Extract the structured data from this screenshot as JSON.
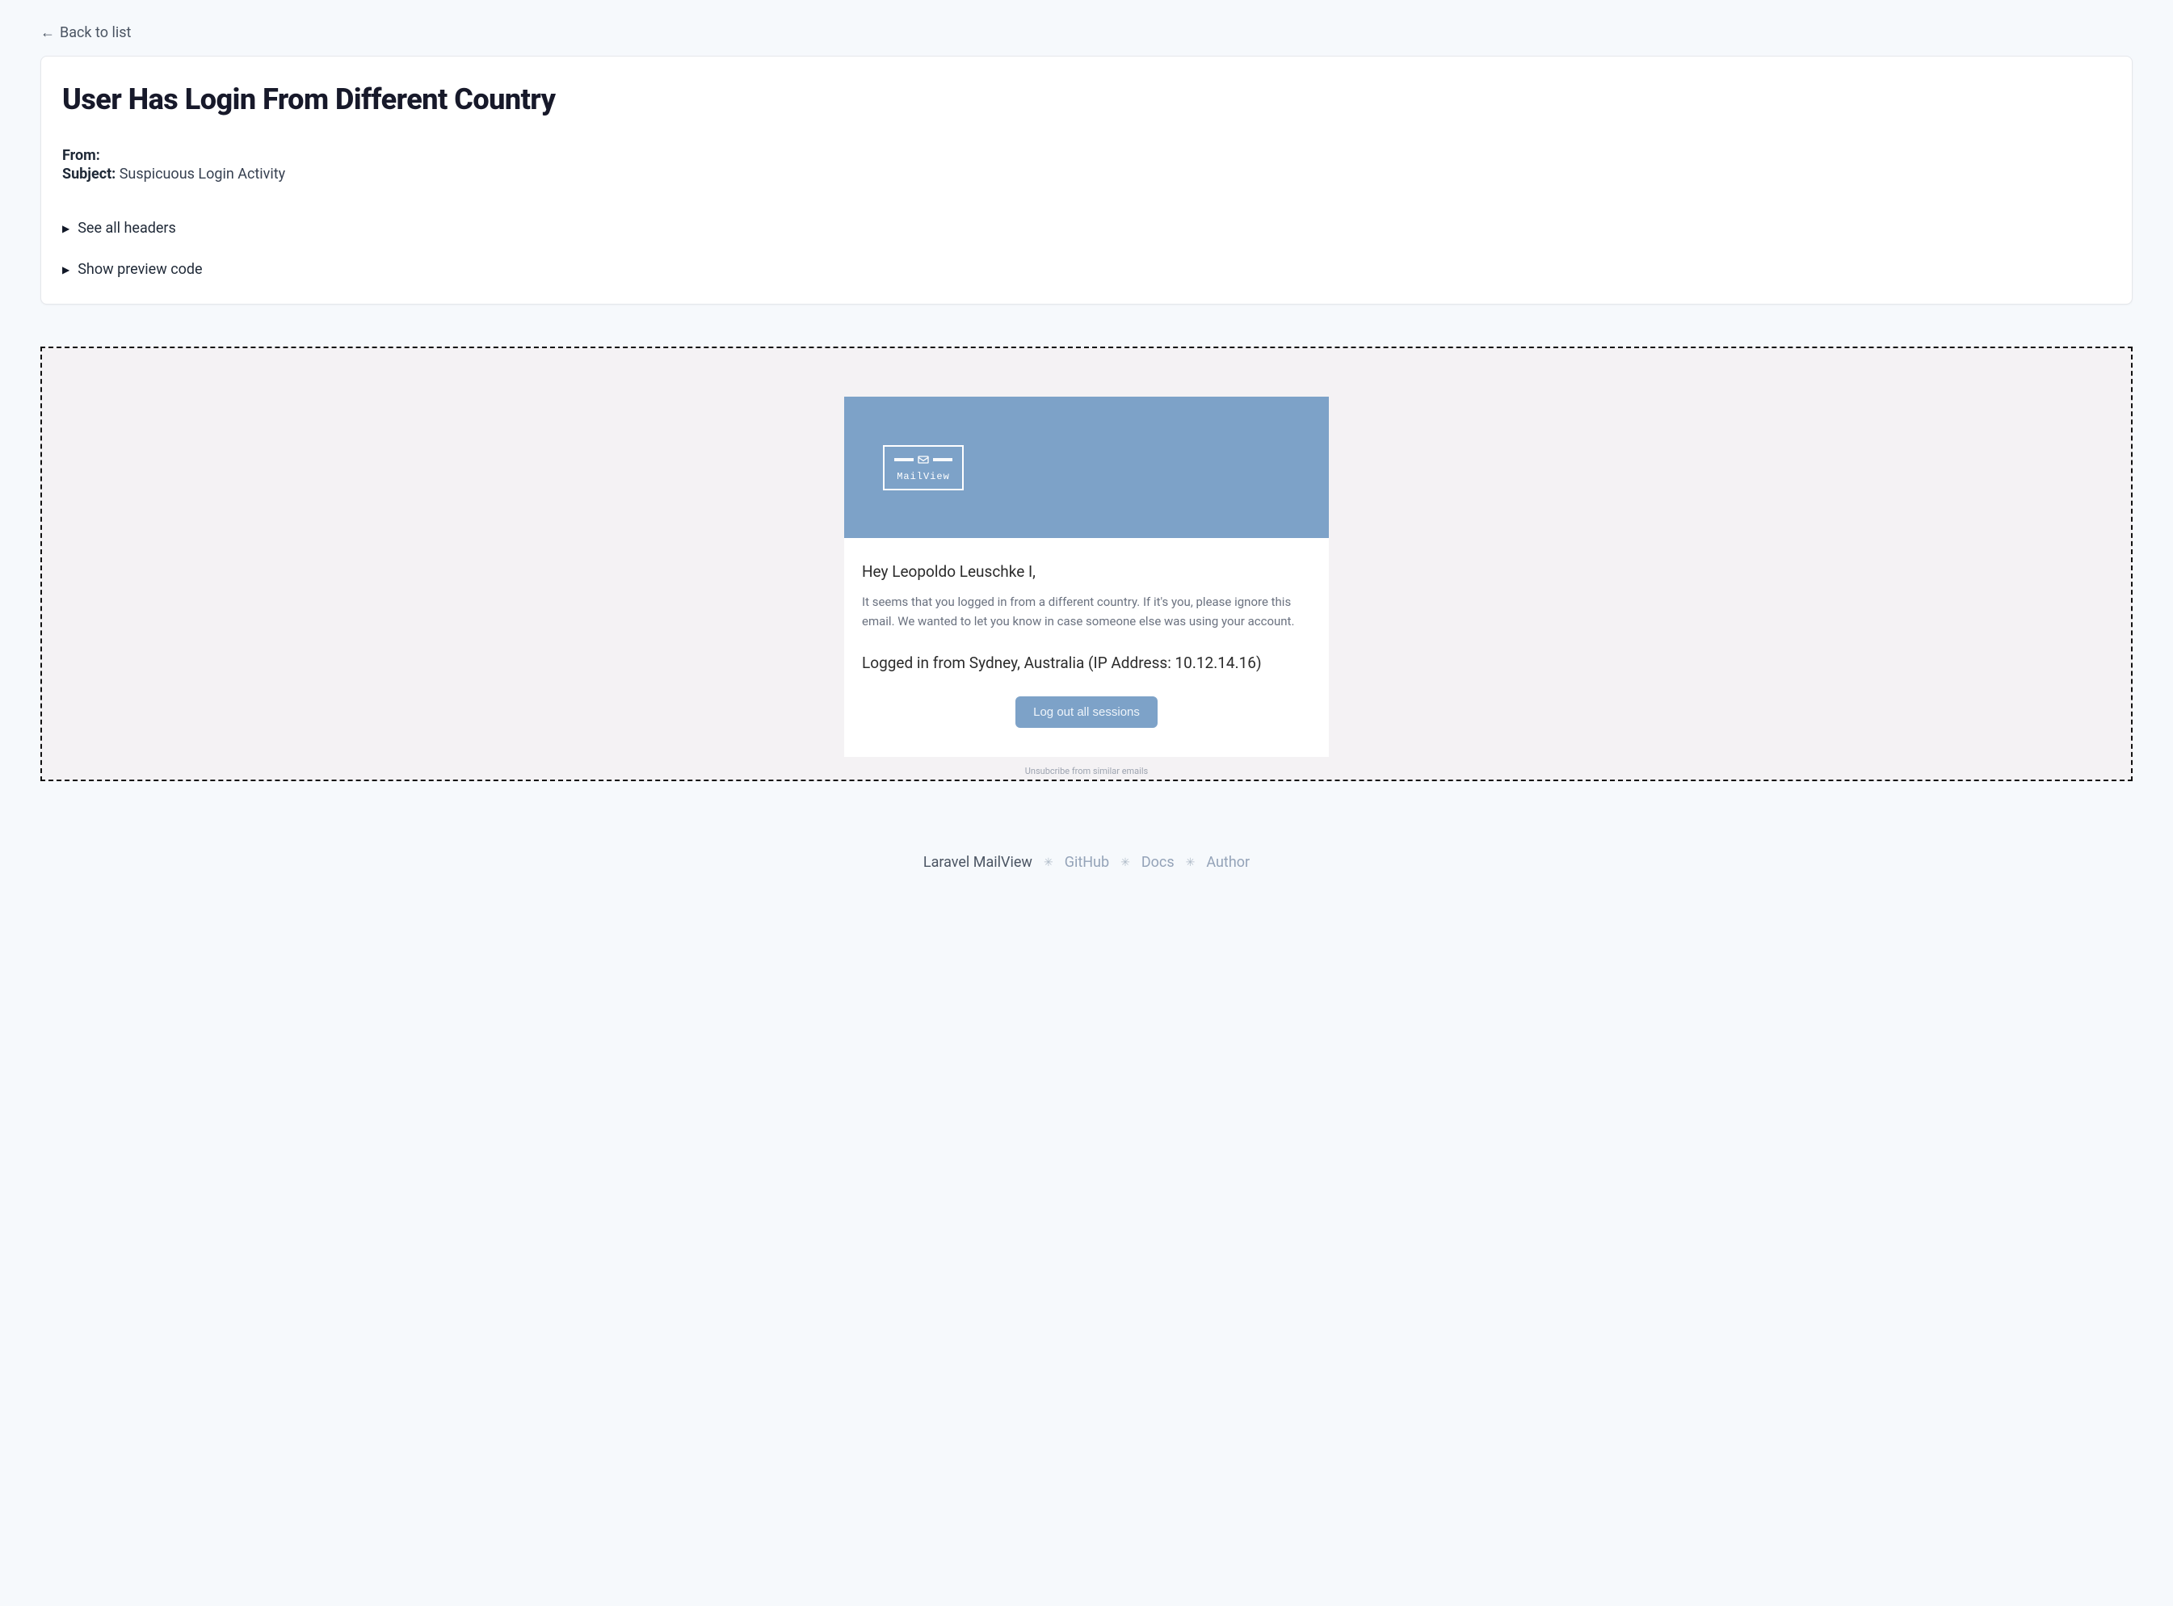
{
  "nav": {
    "back_label": "Back to list"
  },
  "header": {
    "title": "User Has Login From Different Country",
    "from_label": "From:",
    "from_value": "",
    "subject_label": "Subject:",
    "subject_value": "Suspicuous Login Activity"
  },
  "details": {
    "see_headers": "See all headers",
    "show_code": "Show preview code"
  },
  "email": {
    "logo_text": "MailView",
    "greeting": "Hey Leopoldo Leuschke I,",
    "body": "It seems that you logged in from a different country. If it's you, please ignore this email. We wanted to let you know in case someone else was using your account.",
    "login_info": "Logged in from Sydney, Australia (IP Address: 10.12.14.16)",
    "button_label": "Log out all sessions",
    "unsubscribe": "Unsubcribe from similar emails"
  },
  "footer": {
    "brand": "Laravel MailView",
    "links": [
      "GitHub",
      "Docs",
      "Author"
    ]
  }
}
